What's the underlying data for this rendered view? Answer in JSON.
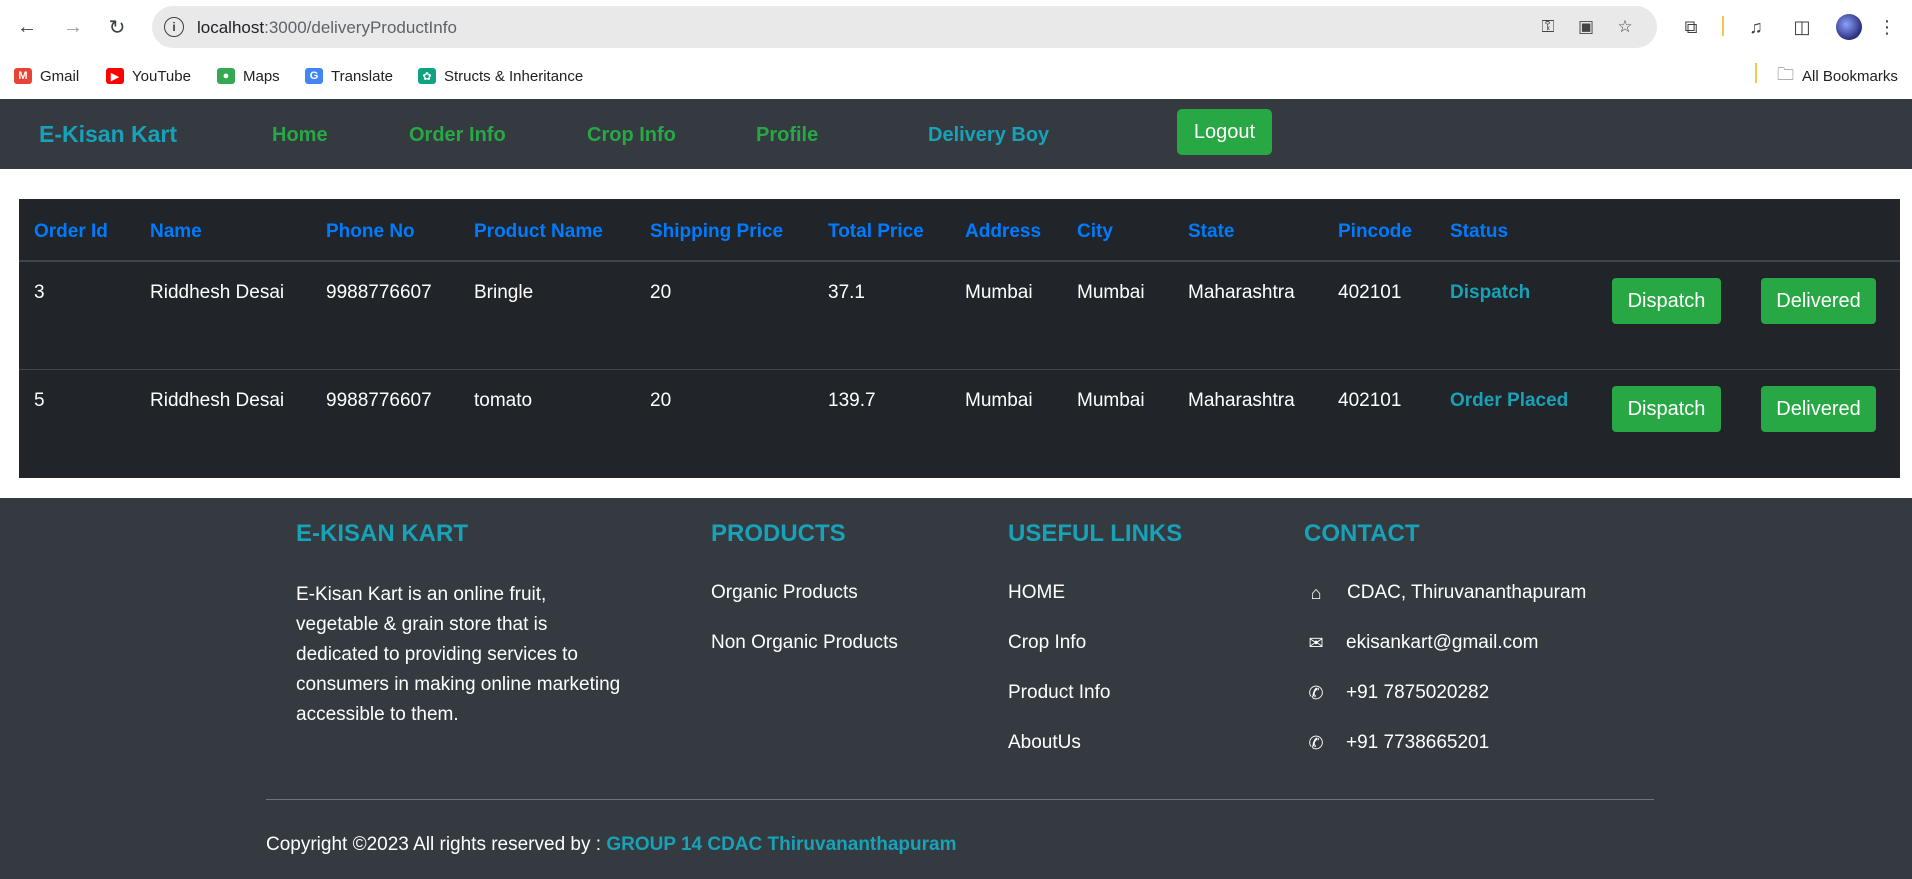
{
  "browser": {
    "url_host": "localhost",
    "url_path": ":3000/deliveryProductInfo",
    "bookmarks": [
      {
        "label": "Gmail",
        "icon": "gmail-icon",
        "color": "#ea4335"
      },
      {
        "label": "YouTube",
        "icon": "youtube-icon",
        "color": "#ff0000"
      },
      {
        "label": "Maps",
        "icon": "maps-icon",
        "color": "#34a853"
      },
      {
        "label": "Translate",
        "icon": "translate-icon",
        "color": "#4285f4"
      },
      {
        "label": "Structs & Inheritance",
        "icon": "chatgpt-icon",
        "color": "#10a37f"
      }
    ],
    "all_bookmarks": "All Bookmarks"
  },
  "nav": {
    "brand": "E-Kisan Kart",
    "links": [
      "Home",
      "Order Info",
      "Crop Info",
      "Profile",
      "Delivery Boy"
    ],
    "logout": "Logout"
  },
  "table": {
    "headers": [
      "Order Id",
      "Name",
      "Phone No",
      "Product Name",
      "Shipping Price",
      "Total Price",
      "Address",
      "City",
      "State",
      "Pincode",
      "Status"
    ],
    "rows": [
      {
        "order_id": "3",
        "name": "Riddhesh Desai",
        "phone": "9988776607",
        "product": "Bringle",
        "shipping": "20",
        "total": "37.1",
        "address": "Mumbai",
        "city": "Mumbai",
        "state": "Maharashtra",
        "pincode": "402101",
        "status": "Dispatch"
      },
      {
        "order_id": "5",
        "name": "Riddhesh Desai",
        "phone": "9988776607",
        "product": "tomato",
        "shipping": "20",
        "total": "139.7",
        "address": "Mumbai",
        "city": "Mumbai",
        "state": "Maharashtra",
        "pincode": "402101",
        "status": "Order Placed"
      }
    ],
    "dispatch_label": "Dispatch",
    "delivered_label": "Delivered"
  },
  "footer": {
    "about_title": "E-KISAN KART",
    "about_text": "E-Kisan Kart is an online fruit, vegetable & grain store that is dedicated to providing services to consumers in making online marketing accessible to them.",
    "products_title": "PRODUCTS",
    "products": [
      "Organic Products",
      "Non Organic Products"
    ],
    "links_title": "USEFUL LINKS",
    "links": [
      "HOME",
      "Crop Info",
      "Product Info",
      "AboutUs"
    ],
    "contact_title": "CONTACT",
    "contact": {
      "address": "CDAC, Thiruvananthapuram",
      "email": "ekisankart@gmail.com",
      "phone1": "+91 7875020282",
      "phone2": "+91 7738665201"
    },
    "copyright_prefix": "Copyright ©2023 All rights reserved by :",
    "copyright_group": "GROUP 14 CDAC Thiruvananthapuram"
  },
  "colors": {
    "navbar": "#343a40",
    "table_bg": "#212529",
    "accent_teal": "#17a2b8",
    "accent_green": "#28a745",
    "header_blue": "#007bff"
  }
}
